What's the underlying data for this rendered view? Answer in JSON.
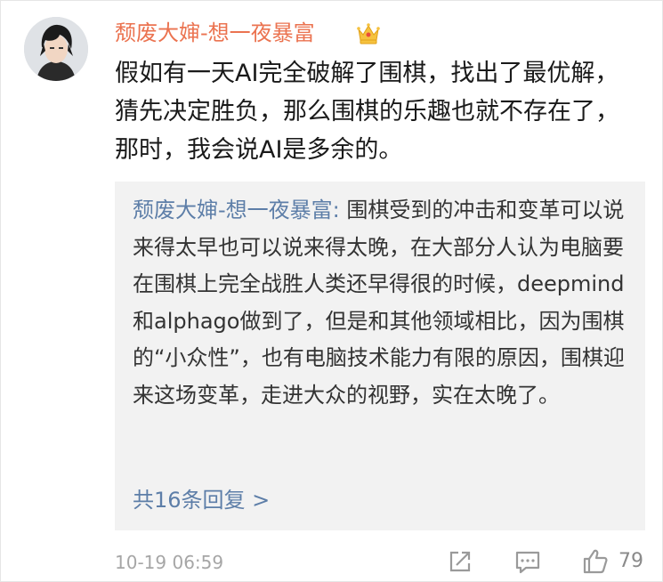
{
  "comment": {
    "username": "颓废大婶-想一夜暴富",
    "badge_icon": "crown-icon",
    "text": "假如有一天AI完全破解了围棋，找出了最优解，猜先决定胜负，那么围棋的乐趣也就不存在了，那时，我会说AI是多余的。",
    "time": "10-19 06:59",
    "like_count": "79"
  },
  "quoted_reply": {
    "author": "颓废大婶-想一夜暴富:",
    "text": " 围棋受到的冲击和变革可以说来得太早也可以说来得太晚，在大部分人认为电脑要在围棋上完全战胜人类还早得很的时候，deepmind和alphago做到了，但是和其他领域相比，因为围棋的“小众性”，也有电脑技术能力有限的原因，围棋迎来这场变革，走进大众的视野，实在太晚了。",
    "more_link": "共16条回复 >"
  },
  "colors": {
    "username": "#eb7350",
    "link": "#5d7ea8",
    "quote_bg": "#f2f2f2",
    "meta": "#a6a6a6"
  }
}
